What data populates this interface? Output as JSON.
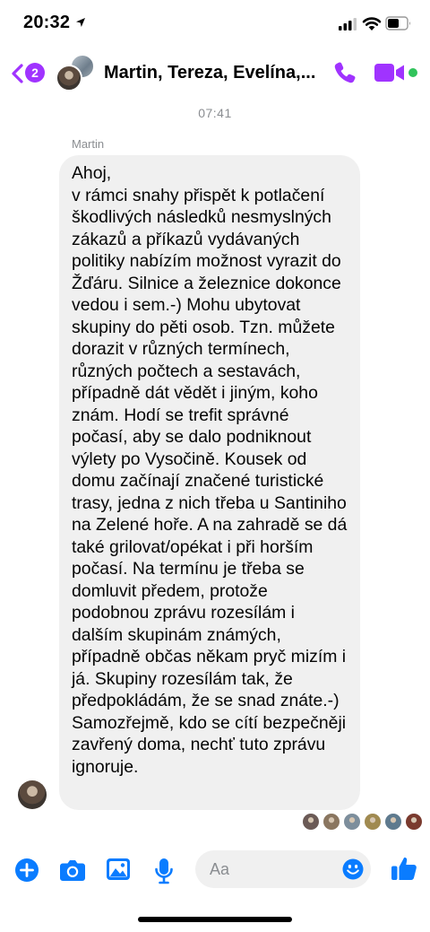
{
  "status_bar": {
    "time": "20:32"
  },
  "header": {
    "unread_count": "2",
    "title": "Martin, Tereza, Evelína,..."
  },
  "conversation": {
    "timestamp": "07:41",
    "sender": "Martin",
    "message": "Ahoj,\nv rámci snahy přispět k potlačení škodlivých následků nesmyslných zákazů a příkazů vydávaných politiky nabízím možnost vyrazit do Žďáru. Silnice a železnice dokonce vedou i sem.-) Mohu ubytovat skupiny do pěti osob. Tzn. můžete dorazit v různých termínech, různých počtech a sestavách, případně dát vědět i jiným, koho znám. Hodí se trefit správné počasí, aby se dalo podniknout výlety po Vysočině. Kousek od domu začínají značené turistické trasy, jedna z nich třeba u Santiniho na Zelené hoře. A na zahradě se dá také grilovat/opékat i při horším počasí. Na termínu je třeba se domluvit předem, protože podobnou zprávu rozesílám i dalším skupinám známých, případně občas někam pryč mizím i já. Skupiny rozesílám tak, že předpokládám, že se snad znáte.-) Samozřejmě, kdo se cítí bezpečněji zavřený doma, nechť tuto zprávu ignoruje.",
    "read_receipts": [
      "#6b5a56",
      "#8a7660",
      "#7d8e9c",
      "#a08a50",
      "#5e7a8e",
      "#7a3a2e"
    ]
  },
  "composer": {
    "placeholder": "Aa"
  },
  "colors": {
    "accent": "#a033ff",
    "blue": "#0a7cff",
    "online": "#31c35b",
    "bubble": "#f0f0f0"
  },
  "icons": [
    "location-arrow-icon",
    "signal-icon",
    "wifi-icon",
    "battery-icon",
    "back-chevron-icon",
    "phone-icon",
    "video-camera-icon",
    "plus-icon",
    "camera-icon",
    "image-icon",
    "microphone-icon",
    "emoji-icon",
    "thumbs-up-icon"
  ]
}
